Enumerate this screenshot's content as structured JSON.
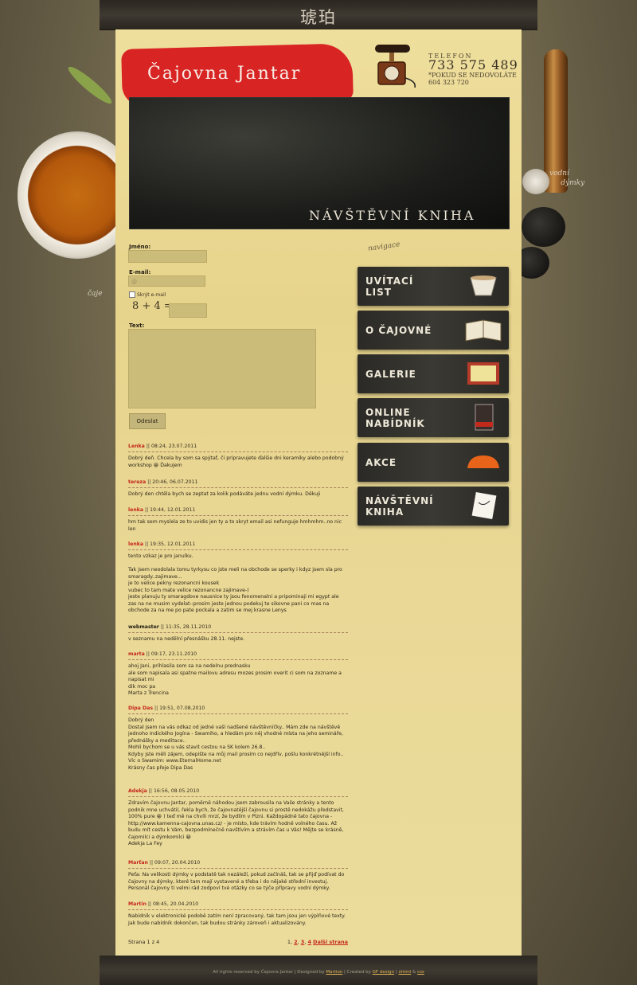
{
  "header": {
    "chinese_title": "琥珀",
    "logo_text": "Čajovna Jantar",
    "phone_label": "TELEFON",
    "phone_number": "733 575 489",
    "phone_note": "*POKUD SE NEDOVOLÁTE\n604 323 720",
    "banner_title": "NÁVŠTĚVNÍ KNIHA"
  },
  "decor": {
    "caje_label": "čaje",
    "pipes_label": "vodní\n     dýmky",
    "nav_hint": "navigace"
  },
  "form": {
    "name_label": "Jméno:",
    "email_label": "E-mail:",
    "email_icon": "@",
    "hide_email_label": "Skrýt e-mail",
    "captcha": "8 + 4 =",
    "text_label": "Text:",
    "submit_label": "Odeslat"
  },
  "entries": [
    {
      "name": "Lenka",
      "date": "08:24, 23.07.2011",
      "body": "Dobrý deň. Chcela by som sa spýtať, či pripravujete ďalšie dni keramiky alebo podobný workshop 😀 Ďakujem"
    },
    {
      "name": "tereza",
      "date": "20:46, 06.07.2011",
      "body": "Dobrý den chtěla bych se zeptat za kolik podáváte jednu vodní dýmku. Děkuji"
    },
    {
      "name": "lenka",
      "date": "19:44, 12.01.2011",
      "body": "hm tak sem myslela ze to uvidis jen ty a to skryt email asi nefunguje hmhmhm..no nic len"
    },
    {
      "name": "lenka",
      "date": "19:35, 12.01.2011",
      "body": "tento vzkaz je pro janulku.\n\nTak jsem neodolala tomu tyrkysu co jste meli na obchode se sperky i kdyz jsem sla pro smaragdy..zajimave...\nje to velice pekny rezonancni kousek\nvubec to tam mate velice rezonancne zajimave-)\njeste planuju ty smaragdove nausnice ty jsou fenomenalni a pripominaji mi egypt ale zas na ne musim vydelat-:prosim jeste jednou podekuj te sikovne pani co mas na obchode za na me po pate pockala a zatim se mej krasne Lenys"
    },
    {
      "name": "webmaster",
      "date": "11:35, 28.11.2010",
      "body": "v seznamu na nedělní přesnášku 28.11. nejste.",
      "dark": true
    },
    {
      "name": "marta",
      "date": "09:17, 23.11.2010",
      "body": "ahoj Jani, prihlasila som sa na nedelnu prednasku\nale som napisala asi spatne mailovu adresu mozes prosim overit ci som na zozname a napisat mi\ndik moc pa\nMarta z Trencina"
    },
    {
      "name": "Dipa Das",
      "date": "19:51, 07.08.2010",
      "body": "Dobrý den\nDostal jsem na vás odkaz od jedné vaší nadšené návštěvníčky.. Mám zde na návštěvě jednoho Indického Jogína - Swamiho, a hledám pro něj vhodné místa na jeho semináře, přednášky a meditace..\nMohli bychom se u vás stavit cestou na SK kolem 26.8..\nKdyby jste měli zájem, odepište na můj mail prosím co nejdřív, pošlu konkrétnější info..\nVíc o Swamim: www.EternalHome.net\nKrásny čas přeje Dipa Das"
    },
    {
      "name": "Adekja",
      "date": "16:56, 08.05.2010",
      "body": "Zdravím čajovnu Jantar, poměrně náhodou jsem zabrousila na Vaše stránky a tento podnik mne uchvátil, řekla bych, že čajovnatější čajovnu si prostě nedokážu představit, 100% pure 😀 ) teď mě na chvíli mrzí, že bydlím v Plzni. Každopádně tato čajovna - http://www.kamenna-cajovna.unas.cz/ - je místo, kde trávím hodně volného času. Až budu mít cestu k Vám, bezpodmínečně navštívím a strávím čas u Vás! Mějte se krásně, čajomilci a dýmkomilci 😀\nAdekja La Fey"
    },
    {
      "name": "Marťan",
      "date": "09:07, 20.04.2010",
      "body": "Peťa: Na velikosti dýmky v podstatě tak nezáleží, pokud začínáš, tak se přijď podívat do čajovny na dýmky, které tam mají vystavené a třeba i do nějaké střední investuj. Personál čajovny ti velmi rád zodpoví tvé otázky co se týče přípravy vodní dýmky."
    },
    {
      "name": "Martin",
      "date": "08:45, 20.04.2010",
      "body": "Nabídník v elektronické podobě zatím není zpracovaný, tak tam jsou jen výplňové texty. Jak bude nabídník dokončen, tak budou stránky zároveň i aktualizovány."
    }
  ],
  "pager": {
    "summary": "Strana 1 z 4",
    "current": "1",
    "pages": [
      "2",
      "3",
      "4"
    ],
    "next_label": "Další strana"
  },
  "nav": [
    {
      "label": "UVÍTACÍ\nLIST",
      "icon": "tea-bowl-icon"
    },
    {
      "label": "O ČAJOVNÉ",
      "icon": "book-icon"
    },
    {
      "label": "GALERIE",
      "icon": "picture-frame-icon"
    },
    {
      "label": "ONLINE\nNABÍDNÍK",
      "icon": "menu-card-icon"
    },
    {
      "label": "AKCE",
      "icon": "cushion-icon"
    },
    {
      "label": "NÁVŠTĚVNÍ\nKNIHA",
      "icon": "paper-sheet-icon"
    }
  ],
  "footer": {
    "prefix": "All rights reserved by Čajovna Jantar | Designed by ",
    "designer": "Martion",
    "mid": " | Created by ",
    "creator": "GF design",
    "sep": " | ",
    "xhtml": "xhtml",
    "amp": " & ",
    "css": "css"
  }
}
